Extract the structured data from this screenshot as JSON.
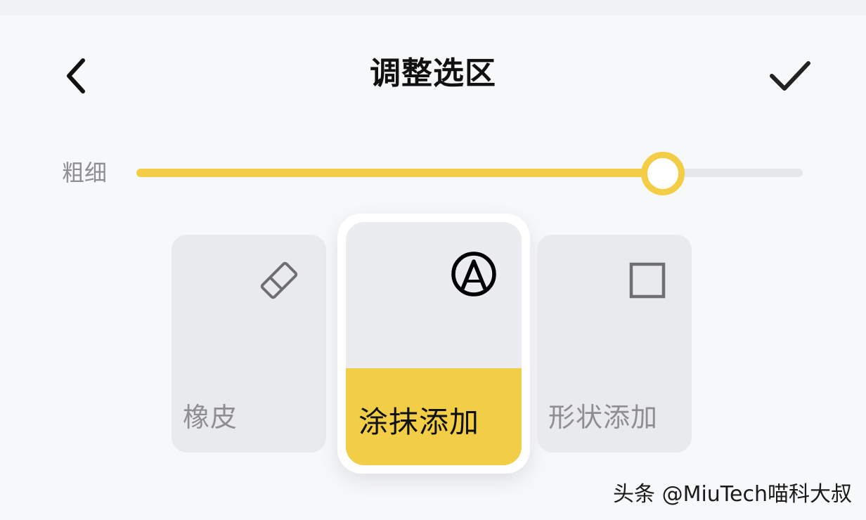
{
  "header": {
    "title": "调整选区",
    "back_icon": "chevron-left-icon",
    "confirm_icon": "checkmark-icon"
  },
  "brush_size": {
    "label": "粗细",
    "level_fraction": 0.79
  },
  "tools": [
    {
      "label": "橡皮",
      "icon": "eraser-icon",
      "selected": false
    },
    {
      "label": "涂抹添加",
      "icon": "brush-circle-icon",
      "selected": true
    },
    {
      "label": "形状添加",
      "icon": "square-icon",
      "selected": false
    }
  ],
  "colors": {
    "accent": "#f3cd46",
    "card_bg": "#e9eaed",
    "text_muted": "#8e8e93",
    "text_primary": "#111111"
  },
  "watermark": "头条 @MiuTech喵科大叔"
}
